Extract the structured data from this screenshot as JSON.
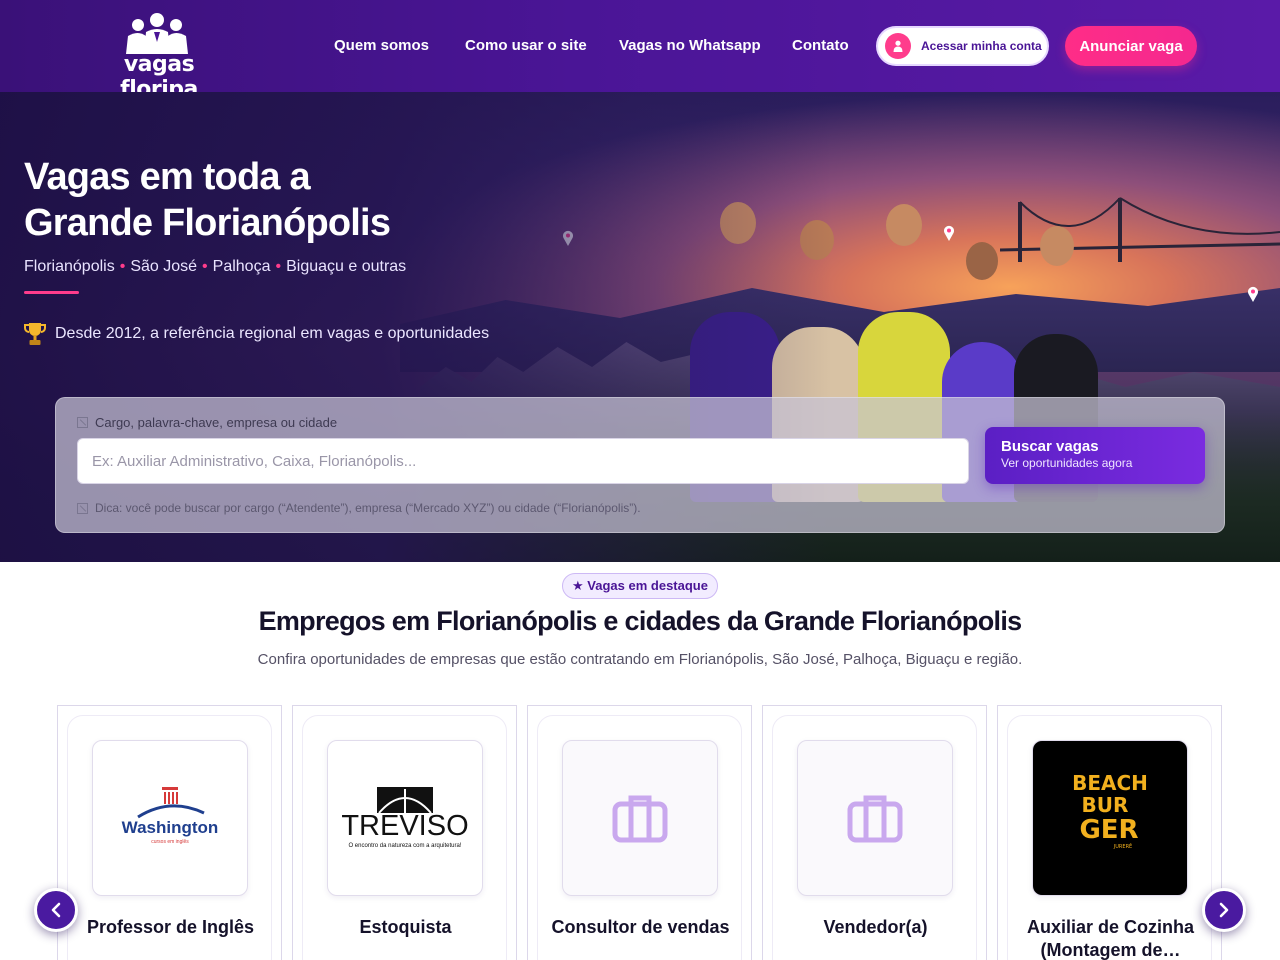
{
  "header": {
    "logo_text": "vagas floripa",
    "nav": [
      "Quem somos",
      "Como usar o site",
      "Vagas no Whatsapp",
      "Contato"
    ],
    "account_label": "Acessar minha conta",
    "cta_label": "Anunciar vaga"
  },
  "hero": {
    "title_line1": "Vagas em toda a",
    "title_line2": "Grande Florianópolis",
    "cities": [
      "Florianópolis",
      "São José",
      "Palhoça",
      "Biguaçu e outras"
    ],
    "since": "Desde 2012, a referência regional em vagas e oportunidades"
  },
  "search": {
    "label": "Cargo, palavra-chave, empresa ou cidade",
    "placeholder": "Ex: Auxiliar Administrativo, Caixa, Florianópolis...",
    "button_title": "Buscar vagas",
    "button_sub": "Ver oportunidades agora",
    "tip": "Dica: você pode buscar por cargo (“Atendente”), empresa (“Mercado XYZ”) ou cidade (“Florianópolis”)."
  },
  "featured": {
    "badge": "★ Vagas em destaque",
    "title": "Empregos em Florianópolis e cidades da Grande Florianópolis",
    "subtitle": "Confira oportunidades de empresas que estão contratando em Florianópolis, São José, Palhoça, Biguaçu e região.",
    "jobs": [
      {
        "title": "Professor de Inglês",
        "logo": "washington-logo",
        "logo_text": "Washington",
        "logo_sub": "cursos em inglês"
      },
      {
        "title": "Estoquista",
        "logo": "treviso-logo",
        "logo_text": "TREVISO",
        "logo_sub": "O encontro da natureza com a arquitetura!"
      },
      {
        "title": "Consultor de vendas",
        "logo": "briefcase-icon"
      },
      {
        "title": "Vendedor(a)",
        "logo": "briefcase-icon"
      },
      {
        "title": "Auxiliar de Cozinha (Montagem de…",
        "logo": "beach-burger-logo",
        "logo_lines": [
          "BEACH",
          "BUR",
          "GER",
          "JURERÊ"
        ]
      }
    ]
  },
  "colors": {
    "header": "#4a1596",
    "accent_pink": "#ff2d87",
    "button_purple": "#5b1fc4"
  }
}
